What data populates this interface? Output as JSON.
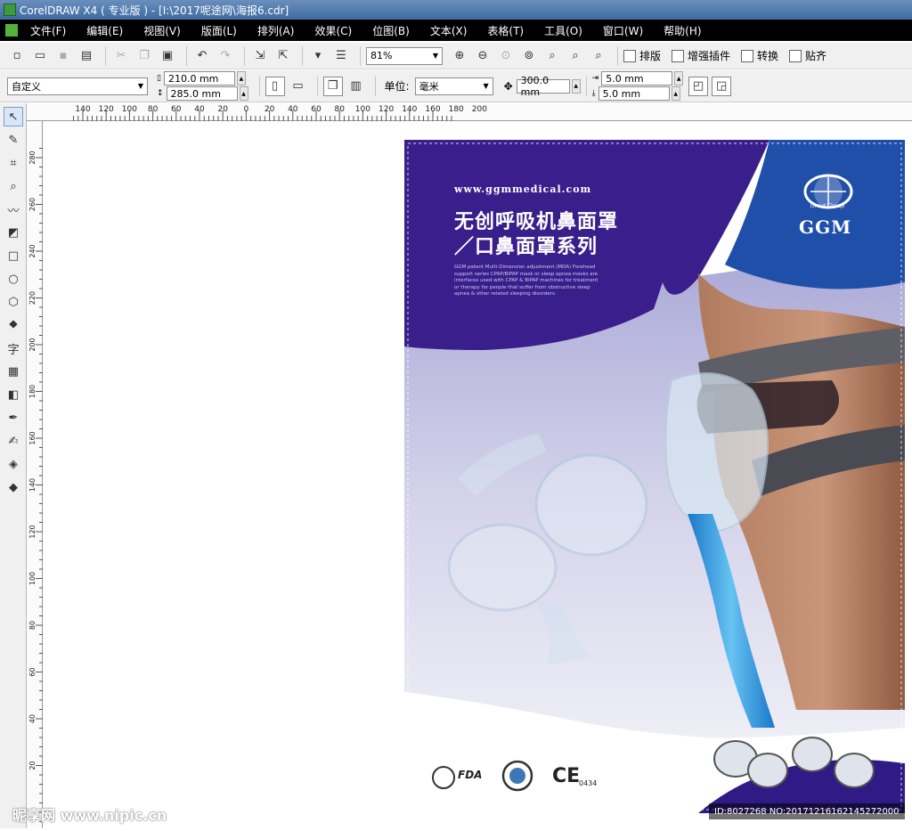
{
  "window": {
    "title": "CorelDRAW X4 ( 专业版 ) - [I:\\2017呢途网\\海报6.cdr]"
  },
  "menu": [
    "文件(F)",
    "编辑(E)",
    "视图(V)",
    "版面(L)",
    "排列(A)",
    "效果(C)",
    "位图(B)",
    "文本(X)",
    "表格(T)",
    "工具(O)",
    "窗口(W)",
    "帮助(H)"
  ],
  "toolbar": {
    "zoom": "81%",
    "buttons": [
      "排版",
      "增强插件",
      "转换",
      "贴齐"
    ]
  },
  "property_bar": {
    "paper_preset": "自定义",
    "width": "210.0 mm",
    "height": "285.0 mm",
    "units_label": "单位:",
    "units": "毫米",
    "nudge": "300.0 mm",
    "dup_x": "5.0 mm",
    "dup_y": "5.0 mm"
  },
  "tools": [
    "pick",
    "shape",
    "crop",
    "zoom",
    "freehand",
    "smart-fill",
    "rectangle",
    "ellipse",
    "polygon",
    "basic-shapes",
    "text",
    "table",
    "interactive",
    "eyedropper",
    "outline",
    "fill",
    "interactive-fill"
  ],
  "ruler": {
    "top_labels": [
      "140",
      "120",
      "100",
      "80",
      "60",
      "40",
      "20",
      "0",
      "20",
      "40",
      "60",
      "80",
      "100",
      "120",
      "140",
      "160",
      "180",
      "200"
    ],
    "left_labels": [
      "280",
      "260",
      "240",
      "220",
      "200",
      "180",
      "160",
      "140",
      "120",
      "100",
      "80",
      "60",
      "40",
      "20"
    ]
  },
  "poster": {
    "url": "www.ggmmedical.com",
    "title_line1": "无创呼吸机鼻面罩",
    "title_line2": "／口鼻面罩系列",
    "description": "GGM patent Multi-Dimension adjustment (MDA) Forehead support series CPAP/BiPAP mask or sleep apnea masks are interfaces used with CPAP & BiPAP machines for treatment or therapy for people that suffer from obstructive sleep apnea & other related sleeping disorders.",
    "logo_text": "GGM",
    "logo_tag": "Great Group",
    "cert_fda": "FDA",
    "cert_ce": "CE",
    "cert_ce_num": "0434",
    "colors": {
      "purple": "#3a1f8c",
      "blue": "#1f4fa8",
      "lavender": "#c9c8e8"
    }
  },
  "watermark": {
    "site": "昵享网 www.nipic.cn",
    "id": "ID:8027268 NO:20171216162145272000"
  }
}
